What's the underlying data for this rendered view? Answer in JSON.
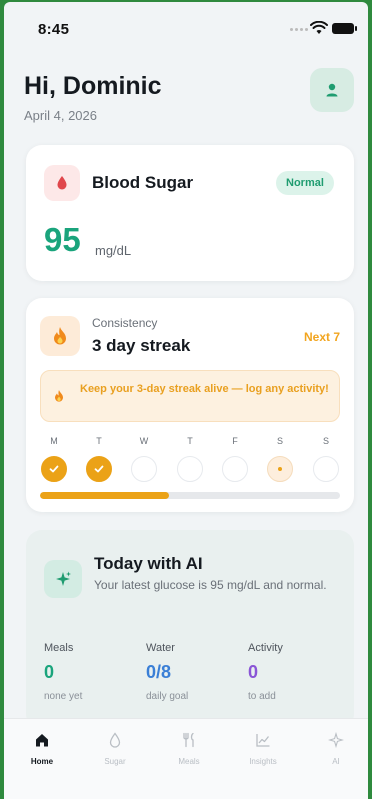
{
  "status_bar": {
    "time": "8:45"
  },
  "header": {
    "greeting": "Hi, Dominic",
    "date": "April 4, 2026"
  },
  "blood_sugar": {
    "title": "Blood Sugar",
    "status": "Normal",
    "value": "95",
    "unit": "mg/dL"
  },
  "streak": {
    "kicker": "Consistency",
    "title": "3 day streak",
    "next_label": "Next 7",
    "alert": "Keep your 3-day streak alive — log any activity!",
    "days": [
      {
        "label": "M",
        "state": "done"
      },
      {
        "label": "T",
        "state": "done"
      },
      {
        "label": "W",
        "state": "empty"
      },
      {
        "label": "T",
        "state": "empty"
      },
      {
        "label": "F",
        "state": "empty"
      },
      {
        "label": "S",
        "state": "today"
      },
      {
        "label": "S",
        "state": "empty"
      }
    ],
    "progress_fraction": 0.43
  },
  "ai_card": {
    "title": "Today with AI",
    "subtitle": "Your latest glucose is 95 mg/dL and normal.",
    "metrics": [
      {
        "label": "Meals",
        "value": "0",
        "note": "none yet",
        "color": "#1aa47c"
      },
      {
        "label": "Water",
        "value": "0/8",
        "note": "daily goal",
        "color": "#3a7fd6"
      },
      {
        "label": "Activity",
        "value": "0",
        "note": "to add",
        "color": "#8a55d6"
      }
    ]
  },
  "tabbar": {
    "tabs": [
      {
        "label": "Home",
        "icon": "home-icon",
        "active": true
      },
      {
        "label": "Sugar",
        "icon": "drop-icon",
        "active": false
      },
      {
        "label": "Meals",
        "icon": "utensils-icon",
        "active": false
      },
      {
        "label": "Insights",
        "icon": "chart-icon",
        "active": false
      },
      {
        "label": "AI",
        "icon": "sparkle-icon",
        "active": false
      }
    ]
  },
  "colors": {
    "accent": "#1aa47c",
    "streak": "#eba217",
    "danger": "#e0474c"
  }
}
